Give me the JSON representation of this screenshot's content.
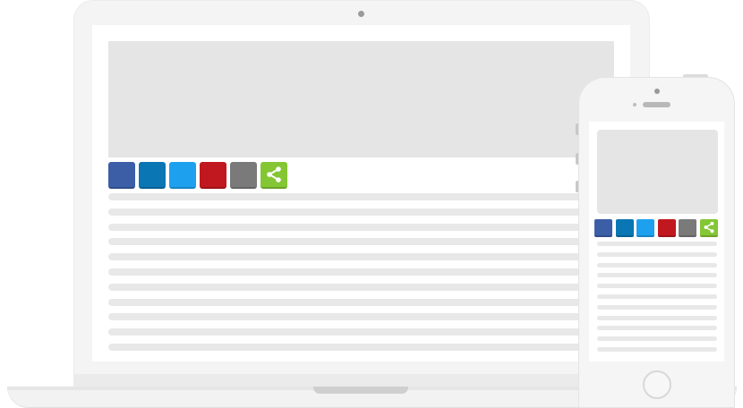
{
  "share_buttons": [
    {
      "name": "facebook-share-button",
      "icon": "facebook-icon",
      "color": "#3b5ea7"
    },
    {
      "name": "linkedin-share-button",
      "icon": "linkedin-icon",
      "color": "#0a76b3"
    },
    {
      "name": "twitter-share-button",
      "icon": "twitter-icon",
      "color": "#1da1ef"
    },
    {
      "name": "pinterest-share-button",
      "icon": "pinterest-icon",
      "color": "#c0181e"
    },
    {
      "name": "email-share-button",
      "icon": "email-icon",
      "color": "#7a7a7a"
    },
    {
      "name": "more-share-button",
      "icon": "share-icon",
      "color": "#84c634"
    }
  ],
  "colors": {
    "device_body": "#f4f4f4",
    "placeholder": "#e5e5e5",
    "text_line": "#e8e8e8",
    "share_glyph": "#ffffff"
  }
}
